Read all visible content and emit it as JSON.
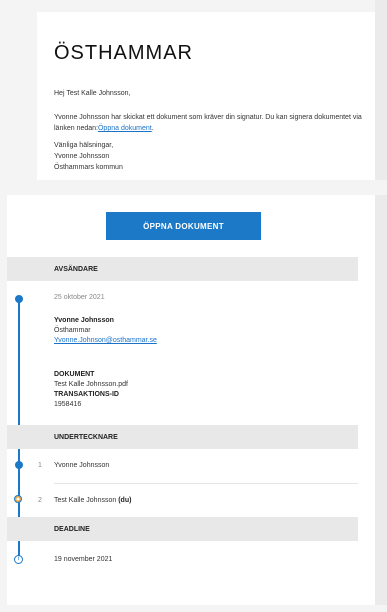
{
  "email": {
    "brand": "ÖSTHAMMAR",
    "greeting": "Hej Test Kalle Johnsson,",
    "message_1": "Yvonne Johnsson har skickat ett dokument som kräver din signatur. Du kan signera dokumentet via länken nedan:",
    "message_link": "Öppna dokument",
    "message_end": ".",
    "sign_1": "Vänliga hälsningar,",
    "sign_2": "Yvonne Johnsson",
    "sign_3": "Östhammars kommun"
  },
  "panel": {
    "open_button": "ÖPPNA DOKUMENT",
    "sender_header": "AVSÄNDARE",
    "date": "25 oktober 2021",
    "sender_name": "Yvonne Johnsson",
    "sender_org": "Östhammar",
    "sender_email": "Yvonne.Johnson@osthammar.se",
    "document_label": "DOKUMENT",
    "document_name": "Test Kalle Johnsson.pdf",
    "transaction_label": "TRANSAKTIONS-ID",
    "transaction_id": "1958416",
    "signers_header": "UNDERTECKNARE",
    "signers": [
      {
        "num": "1",
        "name": "Yvonne Johnsson",
        "suffix": ""
      },
      {
        "num": "2",
        "name": "Test Kalle Johnsson",
        "suffix": "(du)"
      }
    ],
    "deadline_header": "DEADLINE",
    "deadline_date": "19 november 2021"
  },
  "colors": {
    "accent": "#1b79c8",
    "pending": "#f0a030"
  }
}
